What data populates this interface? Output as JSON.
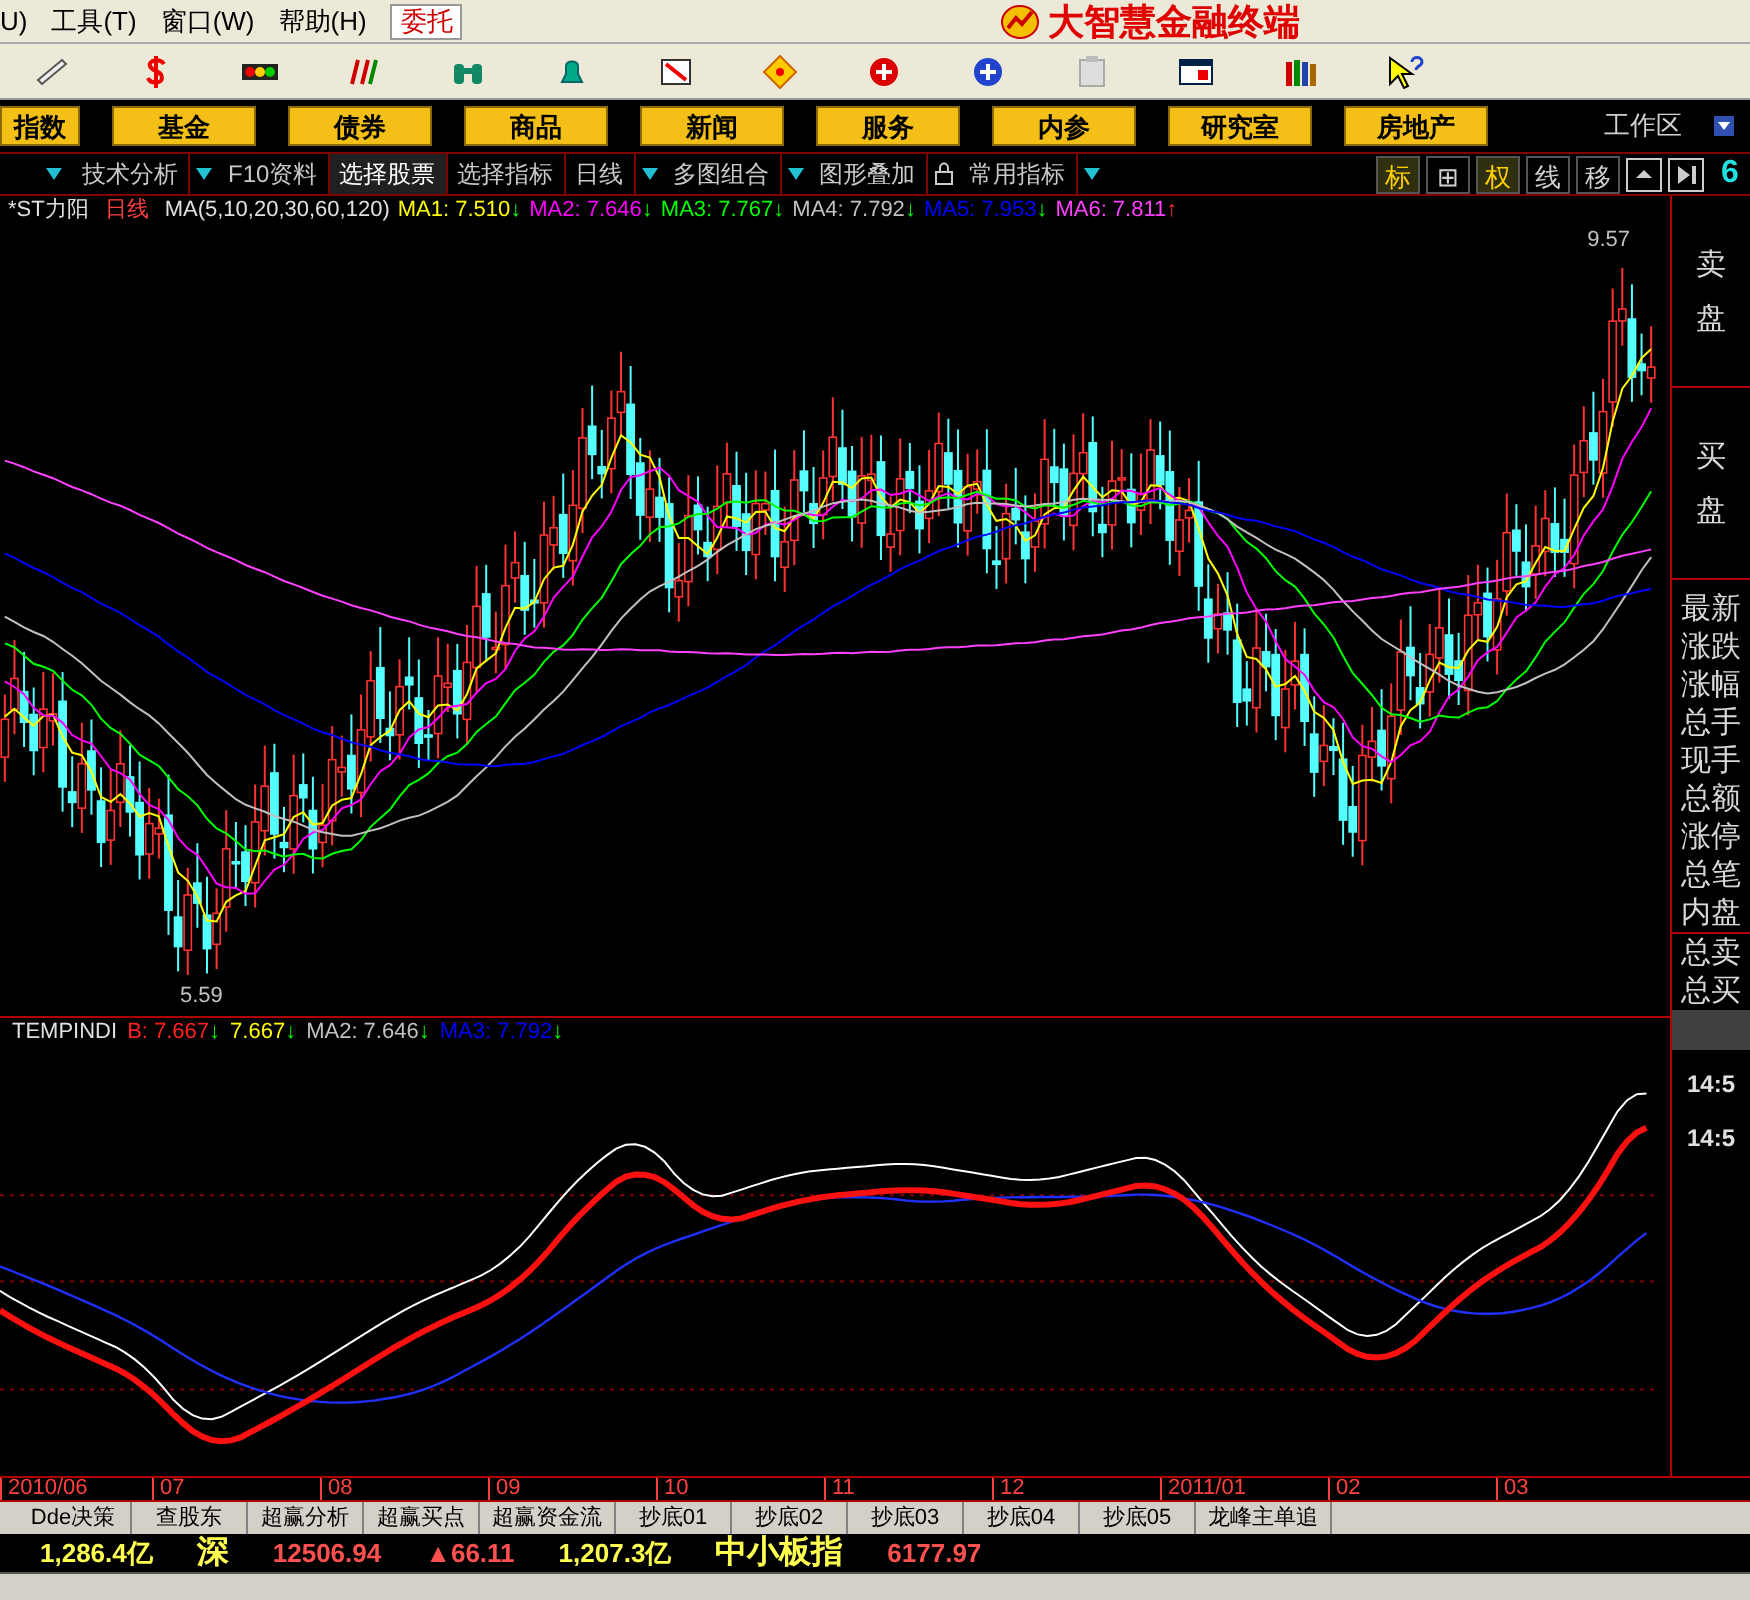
{
  "menu": [
    {
      "label": "U)"
    },
    {
      "label": "工具(T)"
    },
    {
      "label": "窗口(W)"
    },
    {
      "label": "帮助(H)"
    }
  ],
  "order_button": "委托",
  "app_title": "大智慧金融终端",
  "categories": [
    "指数",
    "基金",
    "债券",
    "商品",
    "新闻",
    "服务",
    "内参",
    "研究室",
    "房地产"
  ],
  "workspace": "工作区",
  "tool_strip": [
    {
      "label": "技术分析",
      "dropdown": true,
      "lock": false,
      "selected": false
    },
    {
      "label": "F10资料",
      "dropdown": false,
      "lock": false,
      "selected": false
    },
    {
      "label": "选择股票",
      "dropdown": false,
      "lock": false,
      "selected": true
    },
    {
      "label": "选择指标",
      "dropdown": false,
      "lock": false,
      "selected": false
    },
    {
      "label": "日线",
      "dropdown": true,
      "lock": false,
      "selected": false
    },
    {
      "label": "多图组合",
      "dropdown": true,
      "lock": false,
      "selected": false
    },
    {
      "label": "图形叠加",
      "dropdown": false,
      "lock": true,
      "selected": false
    },
    {
      "label": "常用指标",
      "dropdown": true,
      "lock": false,
      "selected": false
    }
  ],
  "view_buttons": [
    {
      "label": "标",
      "selected": true
    },
    {
      "label": "⊞",
      "selected": false
    },
    {
      "label": "权",
      "selected": true
    },
    {
      "label": "线",
      "selected": false
    },
    {
      "label": "移",
      "selected": false
    }
  ],
  "corner_digit": "6",
  "main_chart": {
    "stock": "*ST力阳",
    "period": "日线",
    "indicator": "MA(5,10,20,30,60,120)",
    "values": [
      {
        "text": "MA1: 7.510",
        "arrow": "↓",
        "rising": false,
        "color": "#ffff00"
      },
      {
        "text": "MA2: 7.646",
        "arrow": "↓",
        "rising": false,
        "color": "#ff00ff"
      },
      {
        "text": "MA3: 7.767",
        "arrow": "↓",
        "rising": false,
        "color": "#00ff00"
      },
      {
        "text": "MA4: 7.792",
        "arrow": "↓",
        "rising": false,
        "color": "#c0c0c0"
      },
      {
        "text": "MA5: 7.953",
        "arrow": "↓",
        "rising": false,
        "color": "#0000ff"
      },
      {
        "text": "MA6: 7.811",
        "arrow": "↑",
        "rising": true,
        "color": "#ff40ff"
      }
    ],
    "high_label": "9.57",
    "low_label": "5.59"
  },
  "sub_chart": {
    "name": "TEMPINDI",
    "values": [
      {
        "text": "B: 7.667",
        "arrow": "↓",
        "rising": false,
        "color": "#ff2020"
      },
      {
        "text": "7.667",
        "arrow": "↓",
        "rising": false,
        "color": "#ffff00"
      },
      {
        "text": "MA2: 7.646",
        "arrow": "↓",
        "rising": false,
        "color": "#c0c0c0"
      },
      {
        "text": "MA3: 7.792",
        "arrow": "↓",
        "rising": false,
        "color": "#0000ff"
      }
    ]
  },
  "side_panel": {
    "sell": [
      "卖",
      "盘"
    ],
    "buy": [
      "买",
      "盘"
    ],
    "fields": [
      "最新",
      "涨跌",
      "涨幅",
      "总手",
      "现手",
      "总额",
      "涨停",
      "总笔",
      "内盘"
    ],
    "totals": [
      "总卖",
      "总买"
    ],
    "times": [
      "14:5",
      "14:5"
    ]
  },
  "date_axis": [
    "2010/06",
    "07",
    "08",
    "09",
    "10",
    "11",
    "12",
    "2011/01",
    "02",
    "03"
  ],
  "bottom_tabs": [
    "Dde决策",
    "查股东",
    "超赢分析",
    "超赢买点",
    "超赢资金流",
    "抄底01",
    "抄底02",
    "抄底03",
    "抄底04",
    "抄底05",
    "龙峰主单追"
  ],
  "status": [
    {
      "text": "1,286.4亿",
      "kind": "amount"
    },
    {
      "text": "深",
      "kind": "market"
    },
    {
      "text": "12506.94",
      "kind": "index"
    },
    {
      "text": "▲66.11",
      "kind": "change"
    },
    {
      "text": "1,207.3亿",
      "kind": "amount"
    },
    {
      "text": "中小板指",
      "kind": "market"
    },
    {
      "text": "6177.97",
      "kind": "index"
    }
  ]
}
